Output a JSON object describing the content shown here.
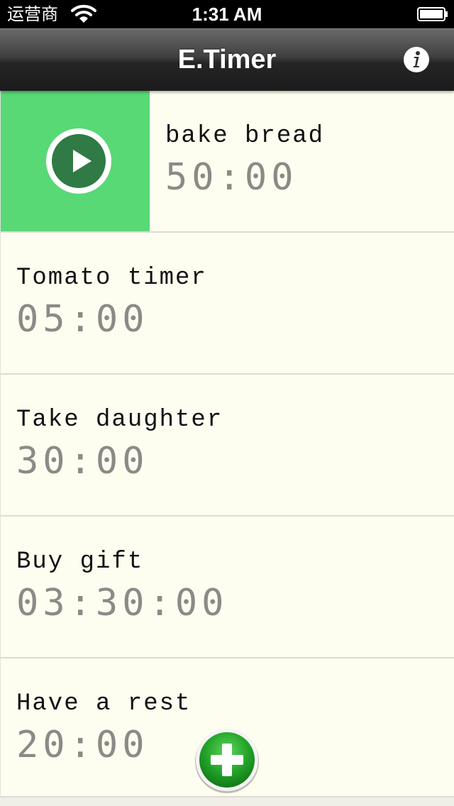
{
  "status_bar": {
    "carrier": "运营商",
    "time": "1:31 AM",
    "wifi_icon": "wifi-icon",
    "battery_icon": "battery-icon"
  },
  "nav": {
    "title": "E.Timer",
    "info_icon": "info-icon"
  },
  "timers": [
    {
      "name": "bake bread",
      "duration": "50:00",
      "active": true
    },
    {
      "name": "Tomato timer",
      "duration": "05:00",
      "active": false
    },
    {
      "name": "Take daughter",
      "duration": "30:00",
      "active": false
    },
    {
      "name": "Buy gift",
      "duration": "03:30:00",
      "active": false
    },
    {
      "name": "Have a rest",
      "duration": "20:00",
      "active": false
    }
  ],
  "colors": {
    "play_green": "#59d876",
    "list_background": "#fdfdf0",
    "time_gray": "#8a8a86",
    "add_button_green": "#22a328"
  },
  "icons": {
    "play": "play-icon",
    "add": "plus-icon"
  }
}
